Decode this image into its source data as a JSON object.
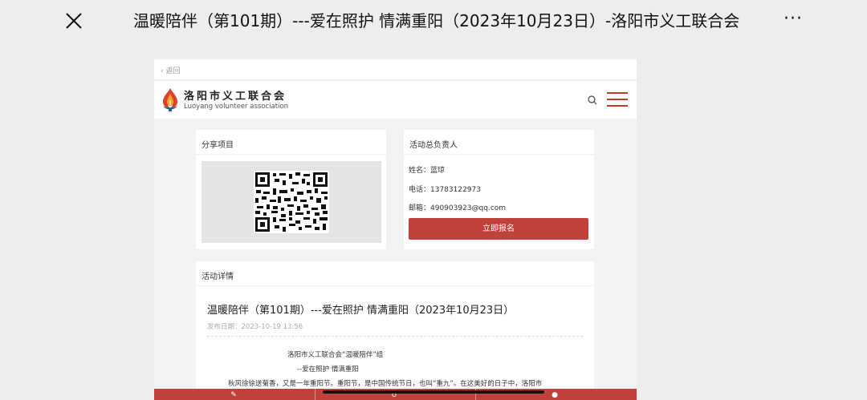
{
  "app_bar": {
    "title": "温暖陪伴（第101期）---爱在照护 情满重阳（2023年10月23日）-洛阳市义工联合会",
    "more_label": "···"
  },
  "page": {
    "back_label": "返回",
    "org_name": "洛阳市义工联合会",
    "org_name_en": "Luoyang volunteer association"
  },
  "share_card": {
    "title": "分享项目"
  },
  "owner_card": {
    "title": "活动总负责人",
    "name_line": "姓名：蓝琼",
    "phone_line": "电话：13783122973",
    "email_line": "邮箱：490903923@qq.com",
    "signup_label": "立即报名"
  },
  "detail_card": {
    "title": "活动详情",
    "article_title": "温暖陪伴（第101期）---爱在照护 情满重阳（2023年10月23日）",
    "pub_date": "发布日期：2023-10-19 13:56",
    "line1": "洛阳市义工联合会“温暖陪伴”组",
    "line2": "--爱在照护 情满重阳",
    "line3": "秋风徐徐送菊香，又是一年重阳节。重阳节，是中国传统节日，也叫“重九”。在这美好的日子中，洛阳市"
  },
  "colors": {
    "accent": "#c0403a",
    "background": "#ededed",
    "card": "#ffffff"
  },
  "icons": [
    "close-icon",
    "more-icon",
    "back-chevron-icon",
    "logo-flame-icon",
    "search-icon",
    "menu-icon",
    "qr-code",
    "edit-icon",
    "user-icon"
  ]
}
